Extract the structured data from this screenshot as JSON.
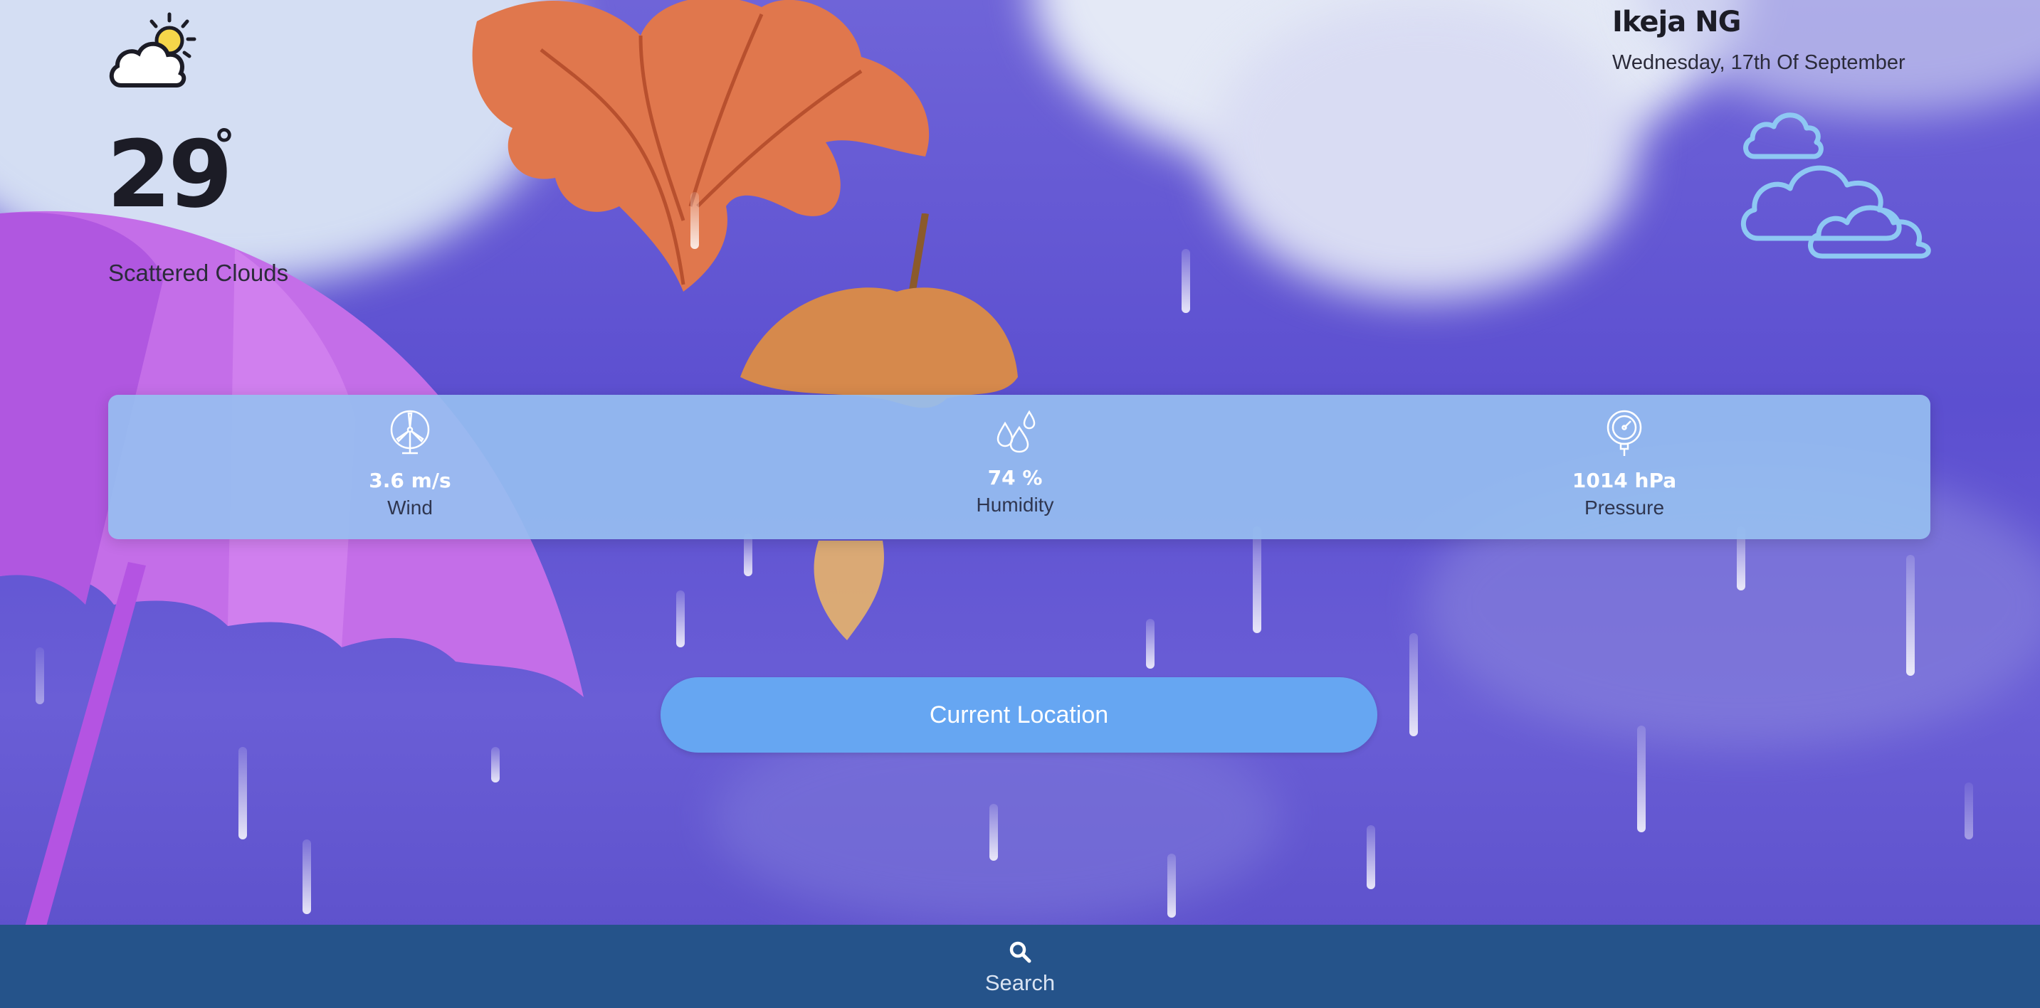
{
  "current": {
    "temperature": "29",
    "degree_symbol": "°",
    "description": "Scattered Clouds",
    "icon": "partly-cloudy-sun-icon"
  },
  "location": {
    "city": "Ikeja NG",
    "date": "Wednesday, 17th Of September",
    "condition_icon": "clouds-outline-icon"
  },
  "stats": {
    "wind": {
      "value": "3.6 m/s",
      "label": "Wind",
      "icon": "wind-turbine-icon"
    },
    "humidity": {
      "value": "74 %",
      "label": "Humidity",
      "icon": "water-drops-icon"
    },
    "pressure": {
      "value": "1014 hPa",
      "label": "Pressure",
      "icon": "pressure-gauge-icon"
    }
  },
  "actions": {
    "current_location": "Current Location"
  },
  "bottom_nav": {
    "search_label": "Search",
    "search_icon": "search-icon"
  },
  "colors": {
    "panel": "#96bef0",
    "button": "#66a6f2",
    "bottom_bar": "#25538a",
    "background": "#5c4fd0"
  }
}
